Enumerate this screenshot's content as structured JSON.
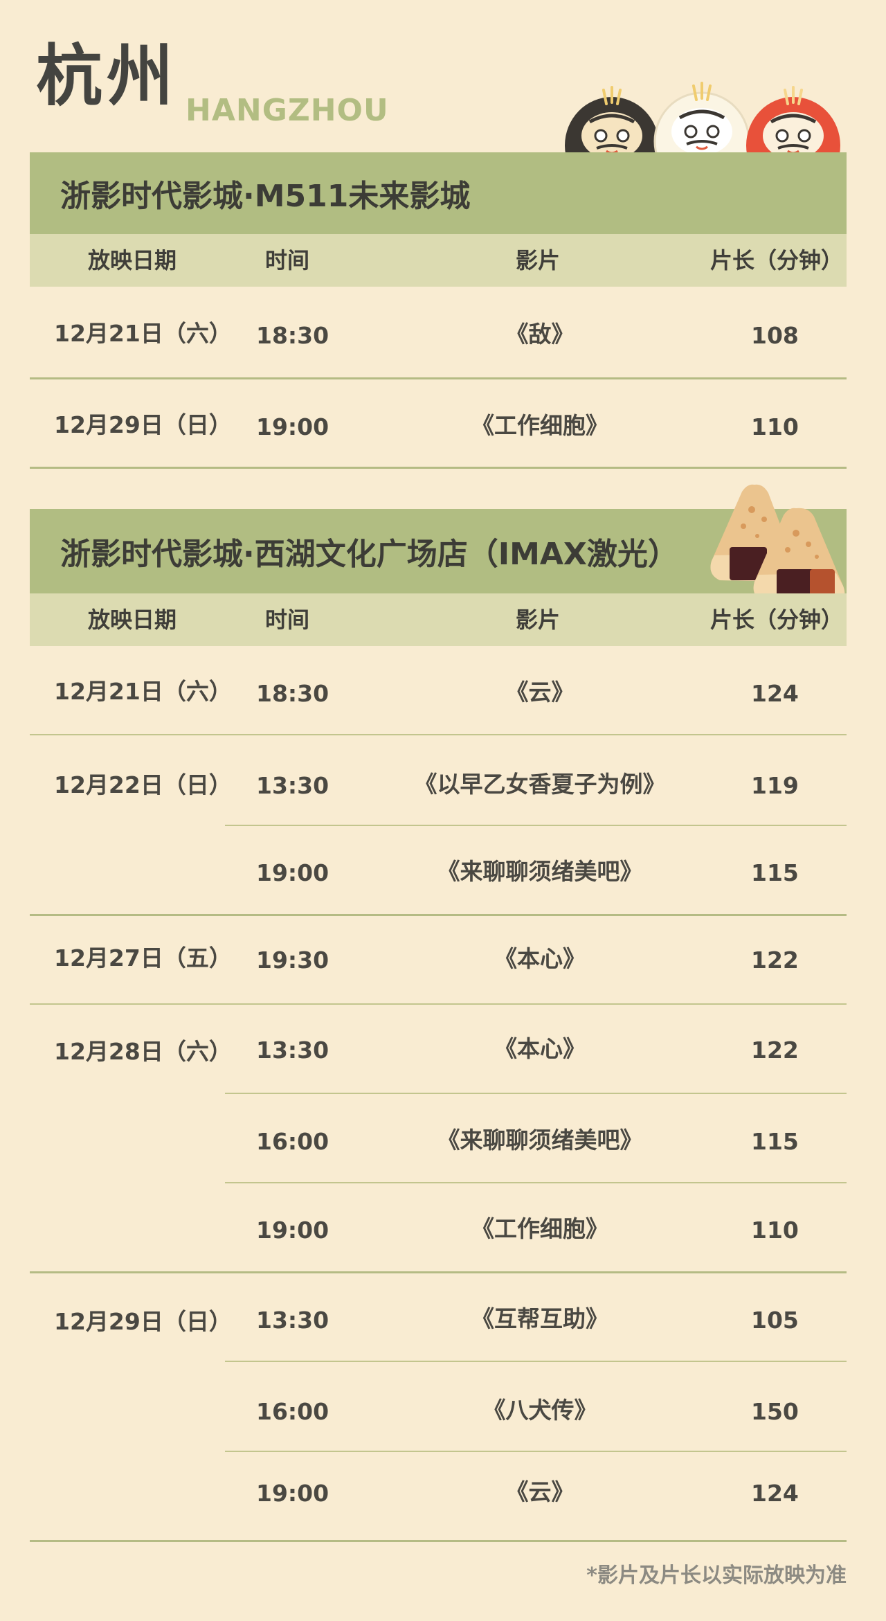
{
  "header": {
    "city": "杭州",
    "city_en": "HANGZHOU"
  },
  "columns": {
    "date": "放映日期",
    "time": "时间",
    "film": "影片",
    "duration": "片长（分钟）"
  },
  "cinemas": [
    {
      "name": "浙影时代影城·M511未来影城",
      "rows": [
        {
          "date": "12月21日（六）",
          "time": "18:30",
          "film": "《敌》",
          "duration": "108"
        },
        {
          "date": "12月29日（日）",
          "time": "19:00",
          "film": "《工作细胞》",
          "duration": "110"
        }
      ]
    },
    {
      "name": "浙影时代影城·西湖文化广场店（IMAX激光）",
      "rows": [
        {
          "date": "12月21日（六）",
          "time": "18:30",
          "film": "《云》",
          "duration": "124"
        },
        {
          "date": "12月22日（日）",
          "time": "13:30",
          "film": "《以早乙女香夏子为例》",
          "duration": "119"
        },
        {
          "date": "",
          "time": "19:00",
          "film": "《来聊聊须绪美吧》",
          "duration": "115"
        },
        {
          "date": "12月27日（五）",
          "time": "19:30",
          "film": "《本心》",
          "duration": "122"
        },
        {
          "date": "12月28日（六）",
          "time": "13:30",
          "film": "《本心》",
          "duration": "122"
        },
        {
          "date": "",
          "time": "16:00",
          "film": "《来聊聊须绪美吧》",
          "duration": "115"
        },
        {
          "date": "",
          "time": "19:00",
          "film": "《工作细胞》",
          "duration": "110"
        },
        {
          "date": "12月29日（日）",
          "time": "13:30",
          "film": "《互帮互助》",
          "duration": "105"
        },
        {
          "date": "",
          "time": "16:00",
          "film": "《八犬传》",
          "duration": "150"
        },
        {
          "date": "",
          "time": "19:00",
          "film": "《云》",
          "duration": "124"
        }
      ]
    }
  ],
  "footnote": "*影片及片长以实际放映为准",
  "colors": {
    "background": "#f9ecd2",
    "cinema_bar": "#b1bd82",
    "column_header": "#dcdbb1",
    "accent_en": "#b2bd82"
  },
  "decorations": [
    "daruma-black-icon",
    "daruma-white-icon",
    "daruma-red-icon",
    "onigiri-icon"
  ]
}
